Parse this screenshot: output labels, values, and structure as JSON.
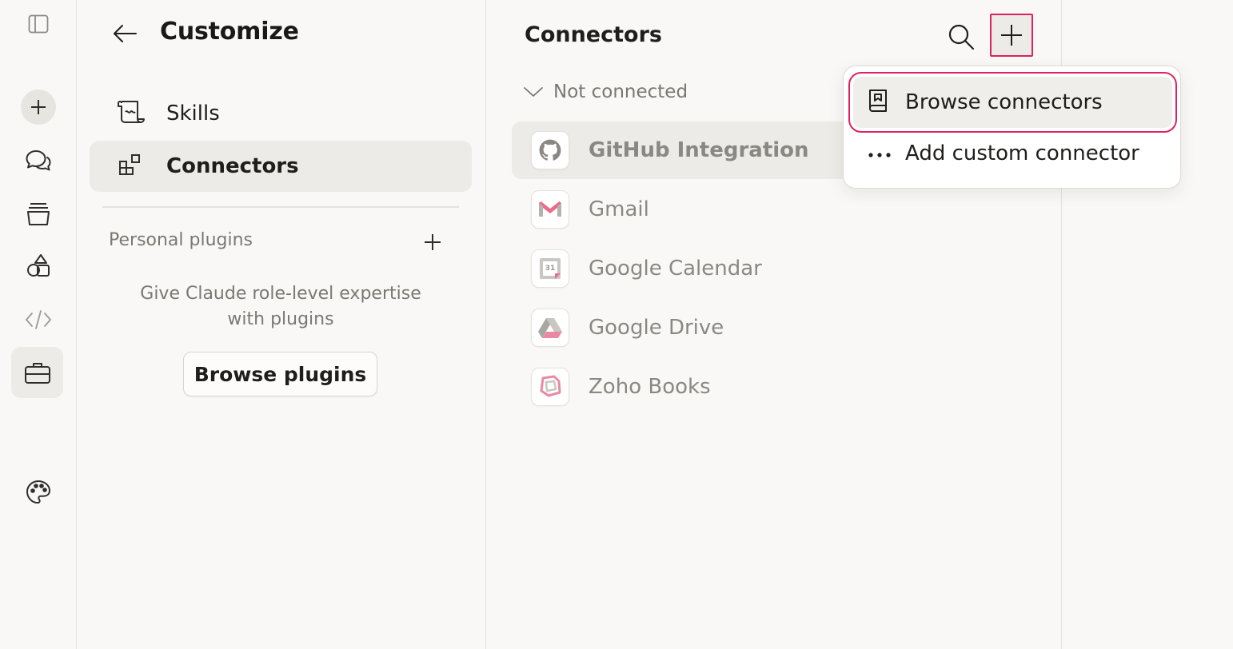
{
  "rail": {
    "icons": [
      "sidebar-toggle-icon",
      "new-chat-icon",
      "chats-icon",
      "projects-icon",
      "artifacts-icon",
      "code-icon",
      "customize-icon",
      "palette-icon"
    ]
  },
  "customize": {
    "title": "Customize",
    "nav": [
      {
        "label": "Skills",
        "icon": "scroll-icon",
        "active": false
      },
      {
        "label": "Connectors",
        "icon": "blocks-icon",
        "active": true
      }
    ],
    "section_label": "Personal plugins",
    "hint": "Give Claude role-level expertise with plugins",
    "browse_plugins_label": "Browse plugins"
  },
  "connectors": {
    "title": "Connectors",
    "group_label": "Not connected",
    "items": [
      {
        "name": "GitHub Integration",
        "icon": "github-icon"
      },
      {
        "name": "Gmail",
        "icon": "gmail-icon"
      },
      {
        "name": "Google Calendar",
        "icon": "google-calendar-icon"
      },
      {
        "name": "Google Drive",
        "icon": "google-drive-icon"
      },
      {
        "name": "Zoho Books",
        "icon": "zoho-books-icon"
      }
    ],
    "calendar_day": "31"
  },
  "menu": {
    "browse_connectors_label": "Browse connectors",
    "add_custom_label": "Add custom connector"
  },
  "colors": {
    "highlight_border": "#e0215f",
    "gmail_red": "#ea6b8a",
    "background": "#f9f8f6"
  }
}
